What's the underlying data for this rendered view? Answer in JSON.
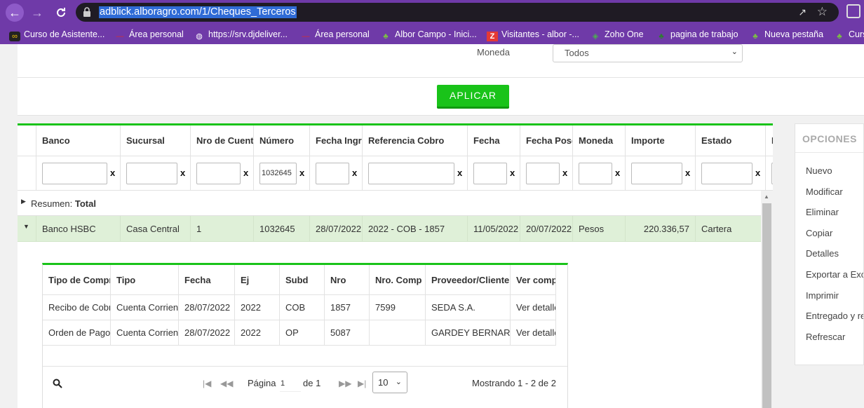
{
  "browser": {
    "url": "adblick.alboragro.com/1/Cheques_Terceros",
    "bookmarks": [
      {
        "label": "Curso de Asistente...",
        "icon": "infinity-icon",
        "color": "#f5c400"
      },
      {
        "label": "Área personal",
        "icon": "dash-icon",
        "color": "#d32f2f"
      },
      {
        "label": "https://srv.djdeliver...",
        "icon": "globe-icon",
        "color": "#ffffff"
      },
      {
        "label": "Área personal",
        "icon": "dash-icon",
        "color": "#d32f2f"
      },
      {
        "label": "Albor Campo - Inici...",
        "icon": "sprout-icon",
        "color": "#7bc043"
      },
      {
        "label": "Visitantes - albor -...",
        "icon": "z-icon",
        "color": "#e53935"
      },
      {
        "label": "Zoho One",
        "icon": "cube-icon",
        "color": "#4caf50"
      },
      {
        "label": "pagina de trabajo",
        "icon": "sprout-icon",
        "color": "#2e7d32"
      },
      {
        "label": "Nueva pestaña",
        "icon": "sprout-icon",
        "color": "#7bc043"
      },
      {
        "label": "Curs",
        "icon": "sprout-icon",
        "color": "#7bc043"
      }
    ]
  },
  "filters": {
    "moneda_label": "Moneda",
    "moneda_value": "Todos",
    "apply_label": "APLICAR"
  },
  "grid": {
    "columns": [
      "Banco",
      "Sucursal",
      "Nro de Cuenta",
      "Número",
      "Fecha Ingreso",
      "Referencia Cobro",
      "Fecha",
      "Fecha Posdatado",
      "Moneda",
      "Importe",
      "Estado",
      "I"
    ],
    "filter_numero": "1032645",
    "filter_clear": "x",
    "summary_label": "Resumen:",
    "summary_value": "Total",
    "row": [
      "Banco HSBC",
      "Casa Central",
      "1",
      "1032645",
      "28/07/2022",
      "2022 - COB - 1857",
      "11/05/2022",
      "20/07/2022",
      "Pesos",
      "220.336,57",
      "Cartera"
    ]
  },
  "detail": {
    "columns": [
      "Tipo de Comprobante",
      "Tipo",
      "Fecha",
      "Ej",
      "Subd",
      "Nro",
      "Nro. Comp",
      "Proveedor/Cliente",
      "Ver comprobante"
    ],
    "rows": [
      [
        "Recibo de Cobro",
        "Cuenta Corriente",
        "28/07/2022",
        "2022",
        "COB",
        "1857",
        "7599",
        "SEDA S.A.",
        "Ver detalle"
      ],
      [
        "Orden de Pago",
        "Cuenta Corriente",
        "28/07/2022",
        "2022",
        "OP",
        "5087",
        "",
        "GARDEY BERNARDO",
        "Ver detalle"
      ]
    ],
    "pager": {
      "page_label": "Página",
      "page_value": "1",
      "of_label": "de 1",
      "page_size": "10",
      "showing": "Mostrando 1 - 2 de 2"
    }
  },
  "options": {
    "title": "OPCIONES",
    "items": [
      "Nuevo",
      "Modificar",
      "Eliminar",
      "Copiar",
      "Detalles",
      "Exportar a Excel",
      "Imprimir",
      "Entregado y recibido",
      "Refrescar"
    ]
  },
  "colors": {
    "accent_green": "#19c319",
    "browser_purple": "#6f3aa8",
    "row_highlight": "#dff0d8"
  }
}
